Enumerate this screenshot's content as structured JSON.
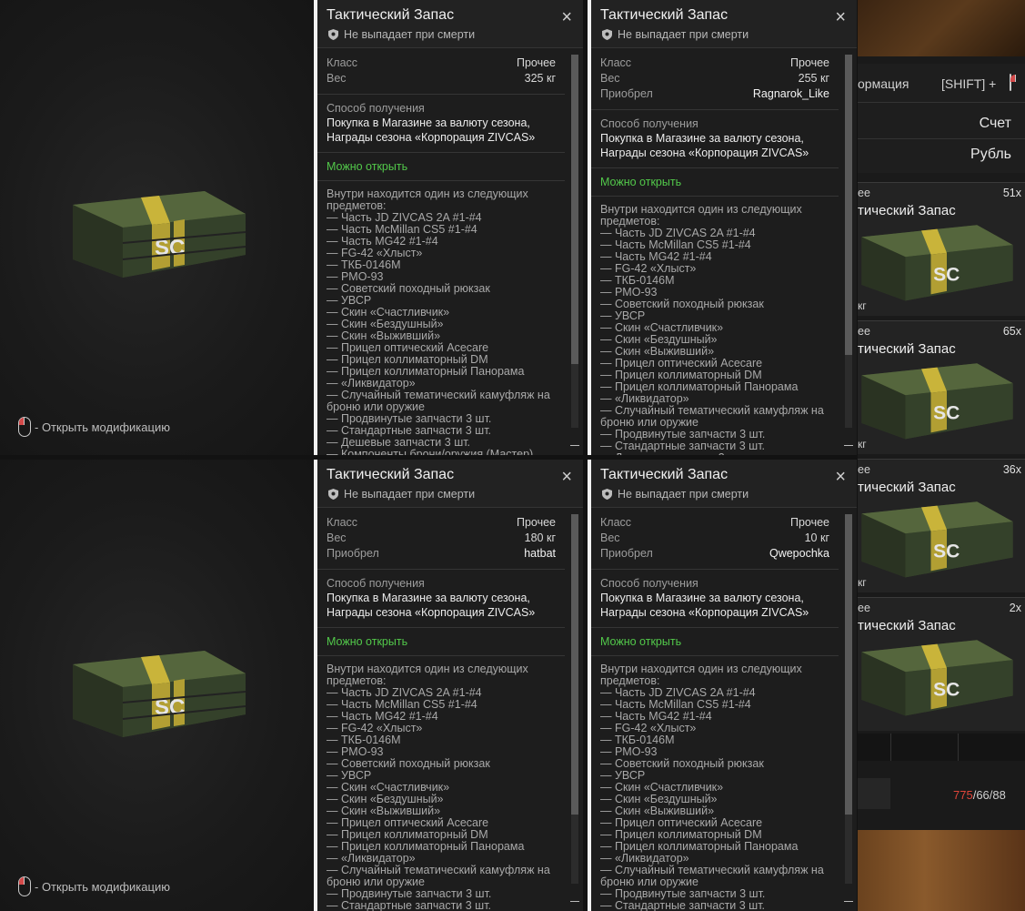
{
  "tooltips": [
    {
      "title": "Тактический Запас",
      "subtitle": "Не выпадает при смерти",
      "stats": [
        {
          "label": "Класс",
          "value": "Прочее"
        },
        {
          "label": "Вес",
          "value": "325 кг"
        }
      ],
      "acquire_title": "Способ получения",
      "acquire_text": "Покупка в Магазине за валюту сезона, Награды сезона «Корпорация ZIVCAS»",
      "can_open": "Можно открыть",
      "contents_intro": "Внутри находится один из следующих предметов:"
    },
    {
      "title": "Тактический Запас",
      "subtitle": "Не выпадает при смерти",
      "stats": [
        {
          "label": "Класс",
          "value": "Прочее"
        },
        {
          "label": "Вес",
          "value": "255 кг"
        },
        {
          "label": "Приобрел",
          "value": "Ragnarok_Like"
        }
      ],
      "acquire_title": "Способ получения",
      "acquire_text": "Покупка в Магазине за валюту сезона, Награды сезона «Корпорация ZIVCAS»",
      "can_open": "Можно открыть",
      "contents_intro": "Внутри находится один из следующих предметов:"
    },
    {
      "title": "Тактический Запас",
      "subtitle": "Не выпадает при смерти",
      "stats": [
        {
          "label": "Класс",
          "value": "Прочее"
        },
        {
          "label": "Вес",
          "value": "180 кг"
        },
        {
          "label": "Приобрел",
          "value": "hatbat"
        }
      ],
      "acquire_title": "Способ получения",
      "acquire_text": "Покупка в Магазине за валюту сезона, Награды сезона «Корпорация ZIVCAS»",
      "can_open": "Можно открыть",
      "contents_intro": "Внутри находится один из следующих предметов:"
    },
    {
      "title": "Тактический Запас",
      "subtitle": "Не выпадает при смерти",
      "stats": [
        {
          "label": "Класс",
          "value": "Прочее"
        },
        {
          "label": "Вес",
          "value": "10 кг"
        },
        {
          "label": "Приобрел",
          "value": "Qwepochka"
        }
      ],
      "acquire_title": "Способ получения",
      "acquire_text": "Покупка в Магазине за валюту сезона, Награды сезона «Корпорация ZIVCAS»",
      "can_open": "Можно открыть",
      "contents_intro": "Внутри находится один из следующих предметов:"
    }
  ],
  "contents_items": [
    "— Часть JD ZIVCAS 2A #1-#4",
    "— Часть McMillan CS5 #1-#4",
    "— Часть MG42 #1-#4",
    "— FG-42 «Хлыст»",
    "— ТКБ-0146М",
    "— PMO-93",
    "— Советский походный рюкзак",
    "— УВСР",
    "— Скин «Счастливчик»",
    "— Скин «Бездушный»",
    "— Скин «Выживший»",
    "— Прицел оптический Acecare",
    "— Прицел коллиматорный DM",
    "— Прицел коллиматорный Панорама",
    "— «Ликвидатор»",
    "— Случайный тематический камуфляж на броню или оружие",
    "— Продвинутые запчасти 3 шт.",
    "— Стандартные запчасти 3 шт.",
    "— Дешевые запчасти 3 шт.",
    "— Компоненты брони/оружия (Мастер)"
  ],
  "preview": {
    "hint": "- Открыть модификацию",
    "hint_icon": "mouse-left-click-icon",
    "crate_icon": "tactical-crate-icon"
  },
  "inventory": {
    "info_tab": "ормация",
    "shift_hint": "[SHIFT] +",
    "account_label": "Счет",
    "currency_label": "Рубль",
    "items": [
      {
        "title": "тический Запас",
        "cat": "ее",
        "count": "51x",
        "weight": "кг"
      },
      {
        "title": "тический Запас",
        "cat": "ее",
        "count": "65x",
        "weight": "кг"
      },
      {
        "title": "тический Запас",
        "cat": "ее",
        "count": "36x",
        "weight": "кг"
      },
      {
        "title": "тический Запас",
        "cat": "ее",
        "count": "2x",
        "weight": ""
      }
    ],
    "ammo_current": "775",
    "ammo_rest": "/66/88"
  },
  "colors": {
    "accent_green": "#52c84a",
    "ammo_red": "#e0453a",
    "panel_border": "#f2f2f2"
  }
}
